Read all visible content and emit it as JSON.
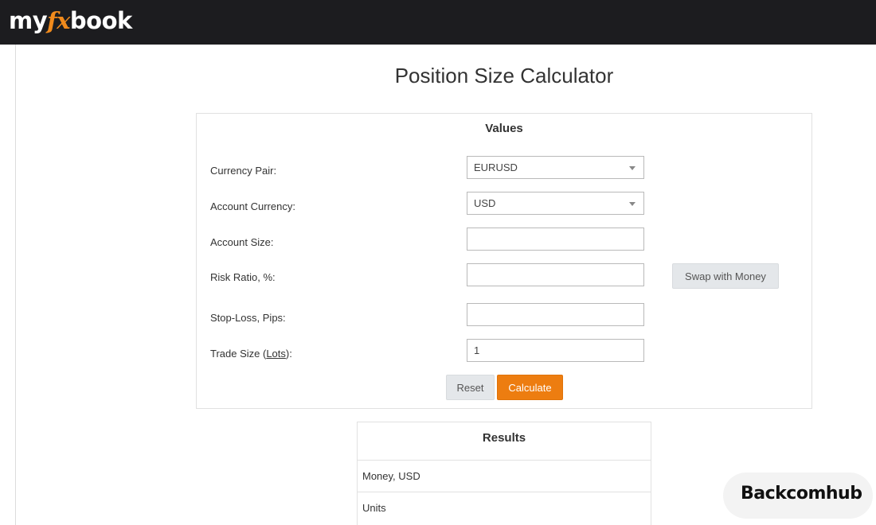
{
  "header": {
    "logo_part1": "my",
    "logo_part2": "fx",
    "logo_part3": "book"
  },
  "page": {
    "title": "Position Size Calculator"
  },
  "values": {
    "heading": "Values",
    "currency_pair": {
      "label": "Currency Pair:",
      "value": "EURUSD"
    },
    "account_currency": {
      "label": "Account Currency:",
      "value": "USD"
    },
    "account_size": {
      "label": "Account Size:",
      "value": ""
    },
    "risk_ratio": {
      "label": "Risk Ratio, %:",
      "value": ""
    },
    "stop_loss": {
      "label": "Stop-Loss, Pips:",
      "value": ""
    },
    "trade_size": {
      "label_prefix": "Trade Size (",
      "label_link": "Lots",
      "label_suffix": "):",
      "value": "1"
    },
    "swap_button": "Swap with Money",
    "reset_button": "Reset",
    "calculate_button": "Calculate"
  },
  "results": {
    "heading": "Results",
    "rows": [
      "Money, USD",
      "Units"
    ]
  },
  "watermark": {
    "text": "Backcomhub"
  },
  "colors": {
    "accent": "#ed7d10",
    "topbar": "#1c1c1f",
    "logo_accent": "#f08a1c"
  }
}
